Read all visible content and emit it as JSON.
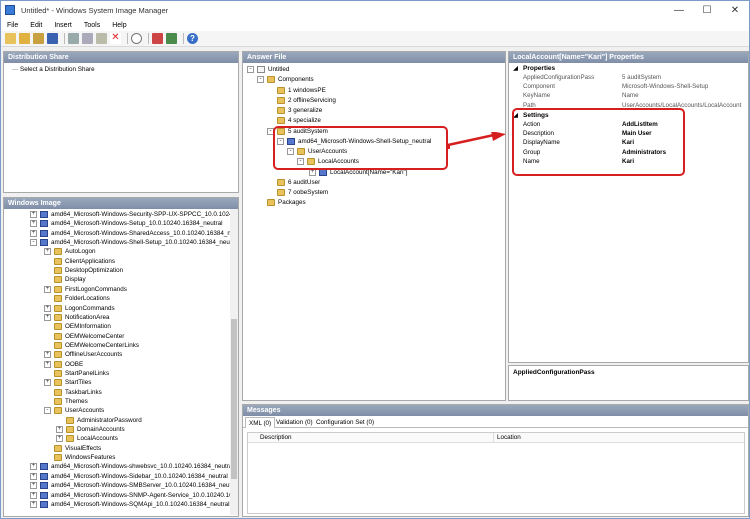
{
  "window": {
    "title": "Untitled* - Windows System Image Manager",
    "controls": [
      "—",
      "☐",
      "✕"
    ]
  },
  "menu": [
    "File",
    "Edit",
    "Insert",
    "Tools",
    "Help"
  ],
  "panes": {
    "distribution_share": {
      "header": "Distribution Share",
      "items": [
        "Select a Distribution Share"
      ]
    },
    "windows_image": {
      "header": "Windows Image",
      "items": [
        "amd64_Microsoft-Windows-Security-SPP-UX-SPPCC_10.0.10240",
        "amd64_Microsoft-Windows-Setup_10.0.10240.16384_neutral",
        "amd64_Microsoft-Windows-SharedAccess_10.0.10240.16384_neu",
        "amd64_Microsoft-Windows-Shell-Setup_10.0.10240.16384_neutr",
        "AutoLogon",
        "ClientApplications",
        "DesktopOptimization",
        "Display",
        "FirstLogonCommands",
        "FolderLocations",
        "LogonCommands",
        "NotificationArea",
        "OEMInformation",
        "OEMWelcomeCenter",
        "OEMWelcomeCenterLinks",
        "OfflineUserAccounts",
        "OOBE",
        "StartPanelLinks",
        "StartTiles",
        "TaskbarLinks",
        "Themes",
        "UserAccounts",
        "AdministratorPassword",
        "DomainAccounts",
        "LocalAccounts",
        "VisualEffects",
        "WindowsFeatures",
        "amd64_Microsoft-Windows-shwebsvc_10.0.10240.16384_neutra",
        "amd64_Microsoft-Windows-Sidebar_10.0.10240.16384_neutral",
        "amd64_Microsoft-Windows-SMBServer_10.0.10240.16384_neutra",
        "amd64_Microsoft-Windows-SNMP-Agent-Service_10.0.10240.163",
        "amd64_Microsoft-Windows-SQMApi_10.0.10240.16384_neutral"
      ]
    },
    "answer_file": {
      "header": "Answer File",
      "items": [
        "Untitled",
        "Components",
        "1 windowsPE",
        "2 offlineServicing",
        "3 generalize",
        "4 specialize",
        "5 auditSystem",
        "amd64_Microsoft-Windows-Shell-Setup_neutral",
        "UserAccounts",
        "LocalAccounts",
        "LocalAccount[Name=\"Kari\"]",
        "6 auditUser",
        "7 oobeSystem",
        "Packages"
      ]
    },
    "properties": {
      "header": "LocalAccount[Name=\"Kari\"] Properties",
      "sections": {
        "properties": "Properties",
        "settings": "Settings"
      },
      "props": [
        {
          "name": "AppliedConfigurationPass",
          "value": "5 auditSystem"
        },
        {
          "name": "Component",
          "value": "Microsoft-Windows-Shell-Setup"
        },
        {
          "name": "KeyName",
          "value": "Name"
        },
        {
          "name": "Path",
          "value": "UserAccounts/LocalAccounts/LocalAccount"
        }
      ],
      "settings": [
        {
          "name": "Action",
          "value": "AddListItem"
        },
        {
          "name": "Description",
          "value": "Main User"
        },
        {
          "name": "DisplayName",
          "value": "Kari"
        },
        {
          "name": "Group",
          "value": "Administrators"
        },
        {
          "name": "Name",
          "value": "Kari"
        }
      ],
      "description_title": "AppliedConfigurationPass"
    },
    "messages": {
      "header": "Messages",
      "tabs": [
        "XML (0)",
        "Validation (0)",
        "Configuration Set (0)"
      ],
      "columns": [
        "Description",
        "Location"
      ]
    }
  },
  "colors": {
    "highlight": "#d62020",
    "pane_header": "#8e9bb2"
  }
}
